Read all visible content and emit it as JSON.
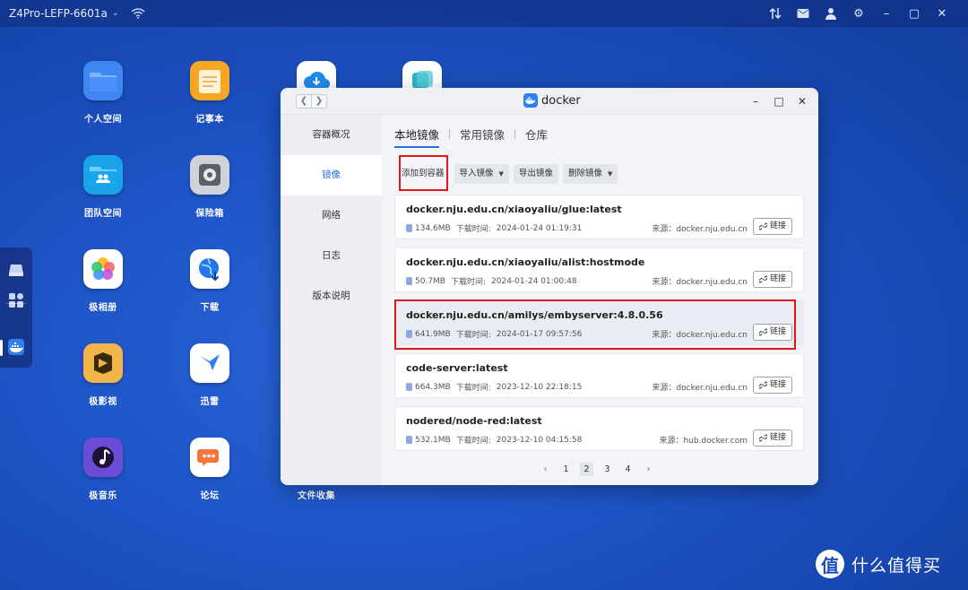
{
  "topbar": {
    "device_name": "Z4Pro-LEFP-6601a",
    "icons": [
      "wifi-icon",
      "transfer-icon",
      "mail-icon",
      "user-icon",
      "settings-icon",
      "minimize-icon",
      "maximize-icon",
      "close-icon"
    ]
  },
  "desktop": {
    "icons": [
      {
        "label": "个人空间",
        "icon": "folder-icon"
      },
      {
        "label": "记事本",
        "icon": "notepad-icon"
      },
      {
        "label": "团队空间",
        "icon": "team-folder-icon"
      },
      {
        "label": "保险箱",
        "icon": "safe-icon"
      },
      {
        "label": "极相册",
        "icon": "photos-icon"
      },
      {
        "label": "下载",
        "icon": "download-globe-icon"
      },
      {
        "label": "极影视",
        "icon": "video-icon"
      },
      {
        "label": "迅雷",
        "icon": "thunder-icon"
      },
      {
        "label": "极音乐",
        "icon": "music-icon"
      },
      {
        "label": "论坛",
        "icon": "forum-icon"
      },
      {
        "label": "文件收集",
        "icon": "file-collect-icon"
      }
    ]
  },
  "window": {
    "title": "docker",
    "sidebar": [
      "容器概况",
      "镜像",
      "网络",
      "日志",
      "版本说明"
    ],
    "active_sidebar": "镜像",
    "tabs": [
      "本地镜像",
      "常用镜像",
      "仓库"
    ],
    "active_tab": "本地镜像",
    "toolbar": {
      "add_to_container": "添加到容器",
      "import_image": "导入镜像",
      "export_image": "导出镜像",
      "delete_image": "删除镜像"
    },
    "images": [
      {
        "name": "docker.nju.edu.cn/xiaoyaliu/glue:latest",
        "size": "134.6MB",
        "time_label": "下载时间:",
        "time": "2024-01-24 01:19:31",
        "source": "来源：docker.nju.edu.cn",
        "link": "链接"
      },
      {
        "name": "docker.nju.edu.cn/xiaoyaliu/alist:hostmode",
        "size": "50.7MB",
        "time_label": "下载时间:",
        "time": "2024-01-24 01:00:48",
        "source": "来源：docker.nju.edu.cn",
        "link": "链接"
      },
      {
        "name": "docker.nju.edu.cn/amilys/embyserver:4.8.0.56",
        "size": "641.9MB",
        "time_label": "下载时间:",
        "time": "2024-01-17 09:57:56",
        "source": "来源：docker.nju.edu.cn",
        "link": "链接"
      },
      {
        "name": "code-server:latest",
        "size": "664.3MB",
        "time_label": "下载时间:",
        "time": "2023-12-10 22:18:15",
        "source": "来源：docker.nju.edu.cn",
        "link": "链接"
      },
      {
        "name": "nodered/node-red:latest",
        "size": "532.1MB",
        "time_label": "下载时间:",
        "time": "2023-12-10 04:15:58",
        "source": "来源：hub.docker.com",
        "link": "链接"
      }
    ],
    "pagination": {
      "prev": "‹",
      "pages": [
        "1",
        "2",
        "3",
        "4"
      ],
      "current": "2",
      "next": "›"
    }
  },
  "watermark": {
    "logo": "值",
    "text": "什么值得买"
  },
  "colors": {
    "accent": "#2c6de8",
    "highlight": "#e0161b",
    "desktop_bg": "#1f56c9"
  }
}
